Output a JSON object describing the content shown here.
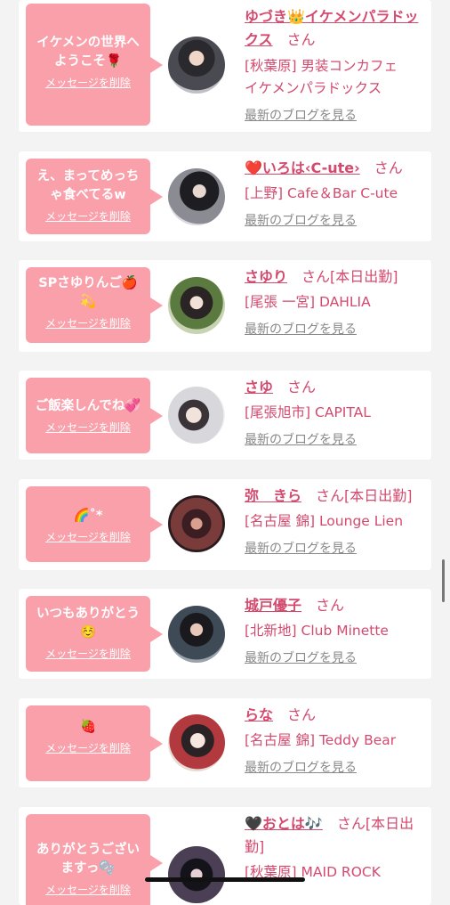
{
  "colors": {
    "accent": "#d34a6e",
    "bubble": "#f9a0ab",
    "background": "#f3f3f3"
  },
  "cards": [
    {
      "message": "イケメンの世界へ\nようこそ🌹",
      "delete_label": "メッセージを削除",
      "name": "ゆづき👑イケメンパラドックス",
      "san": "さん",
      "status": "",
      "shop": "[秋葉原] 男装コンカフェ\nイケメンパラドックス",
      "blog": "最新のブログを見る"
    },
    {
      "message": "え、まってめっち\nゃ食べてるw",
      "delete_label": "メッセージを削除",
      "name": "❤️いろは‹C-ute›",
      "san": "さん",
      "status": "",
      "shop": "[上野] Cafe＆Bar C-ute",
      "blog": "最新のブログを見る"
    },
    {
      "message": "SPさゆりんご🍎\n💫",
      "delete_label": "メッセージを削除",
      "name": "さゆり",
      "san": "さん",
      "status": "[本日出勤]",
      "shop": "[尾張 一宮] DAHLIA",
      "blog": "最新のブログを見る"
    },
    {
      "message": "ご飯楽しんでね💞",
      "delete_label": "メッセージを削除",
      "name": "さゆ",
      "san": "さん",
      "status": "",
      "shop": "[尾張旭市] CAPITAL",
      "blog": "最新のブログを見る"
    },
    {
      "message": "🌈˚*",
      "delete_label": "メッセージを削除",
      "name": "弥　きら",
      "san": "さん",
      "status": "[本日出勤]",
      "shop": "[名古屋 錦] Lounge Lien",
      "blog": "最新のブログを見る"
    },
    {
      "message": "いつもありがとう\n☺️",
      "delete_label": "メッセージを削除",
      "name": "城戸優子",
      "san": "さん",
      "status": "",
      "shop": "[北新地] Club Minette",
      "blog": "最新のブログを見る"
    },
    {
      "message": "🍓",
      "delete_label": "メッセージを削除",
      "name": "らな",
      "san": "さん",
      "status": "",
      "shop": "[名古屋 錦] Teddy Bear",
      "blog": "最新のブログを見る"
    },
    {
      "message": "ありがとうござい\nますっ🫧",
      "delete_label": "メッセージを削除",
      "name": "🖤おとは🎶",
      "san": "さん",
      "status": "[本日出勤]",
      "shop": "[秋葉原] MAID ROCK",
      "blog": "最新のブログを見る"
    }
  ]
}
